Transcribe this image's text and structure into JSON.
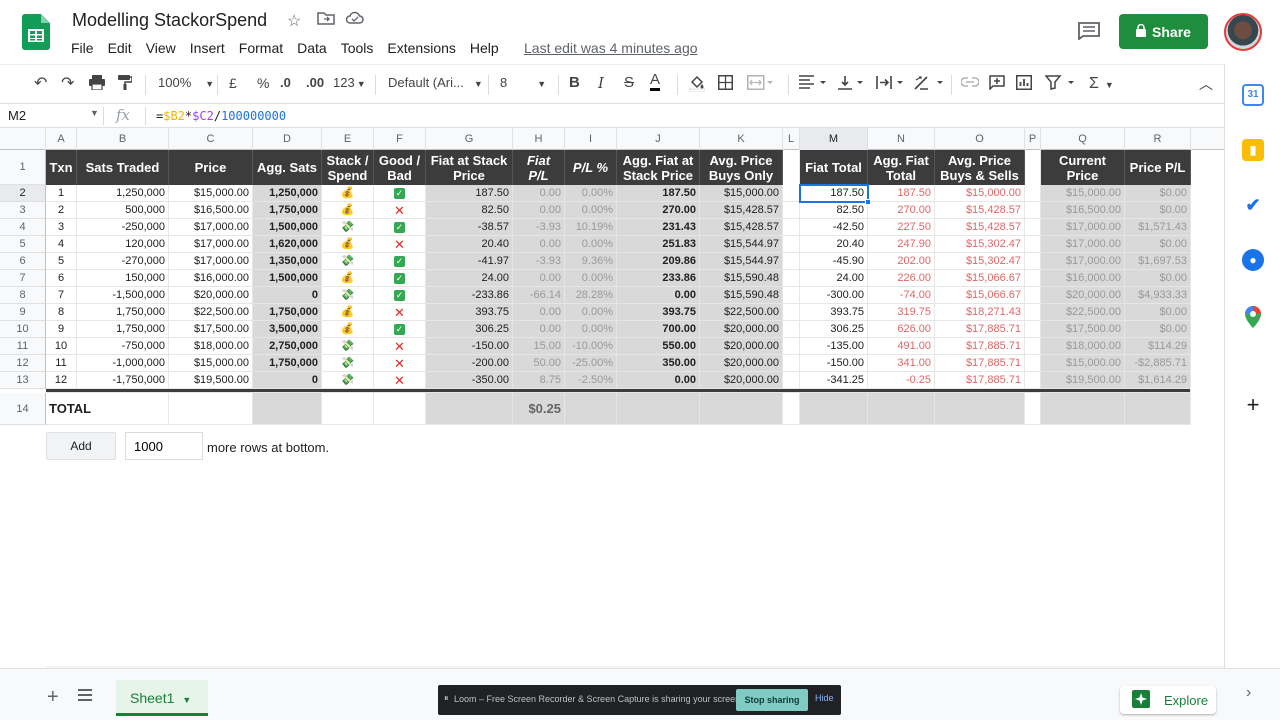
{
  "header": {
    "title": "Modelling StackorSpend",
    "menus": [
      "File",
      "Edit",
      "View",
      "Insert",
      "Format",
      "Data",
      "Tools",
      "Extensions",
      "Help"
    ],
    "last_edit": "Last edit was 4 minutes ago",
    "share_label": "Share"
  },
  "toolbar": {
    "zoom": "100%",
    "currency": "£",
    "percent": "%",
    "dec_decrease": ".0",
    "dec_increase": ".00",
    "more_formats": "123",
    "font": "Default (Ari...",
    "font_size": "8"
  },
  "formula_bar": {
    "name_box": "M2",
    "fx": "fx",
    "formula_prefix": "=",
    "formula_b": "$B2",
    "formula_op1": "*",
    "formula_c": "$C2",
    "formula_op2": "/",
    "formula_num": "100000000"
  },
  "columns": [
    "A",
    "B",
    "C",
    "D",
    "E",
    "F",
    "G",
    "H",
    "I",
    "J",
    "K",
    "L",
    "M",
    "N",
    "O",
    "P",
    "Q",
    "R"
  ],
  "selected_column": "M",
  "header_row": {
    "A": "Txn",
    "B": "Sats Traded",
    "C": "Price",
    "D": "Agg. Sats",
    "E": "Stack / Spend",
    "F": "Good / Bad",
    "G": "Fiat at Stack Price",
    "H": "Fiat P/L",
    "I": "P/L %",
    "J": "Agg. Fiat at Stack Price",
    "K": "Avg. Price Buys Only",
    "M": "Fiat Total",
    "N": "Agg. Fiat Total",
    "O": "Avg. Price Buys & Sells",
    "Q": "Current Price",
    "R": "Price P/L"
  },
  "rows": [
    {
      "A": "1",
      "B": "1,250,000",
      "C": "$15,000.00",
      "D": "1,250,000",
      "E": "stack",
      "F": "good",
      "G": "187.50",
      "H": "0.00",
      "I": "0.00%",
      "J": "187.50",
      "K": "$15,000.00",
      "M": "187.50",
      "N": "187.50",
      "O": "$15,000.00",
      "Q": "$15,000.00",
      "R": "$0.00"
    },
    {
      "A": "2",
      "B": "500,000",
      "C": "$16,500.00",
      "D": "1,750,000",
      "E": "stack",
      "F": "bad",
      "G": "82.50",
      "H": "0.00",
      "I": "0.00%",
      "J": "270.00",
      "K": "$15,428.57",
      "M": "82.50",
      "N": "270.00",
      "O": "$15,428.57",
      "Q": "$16,500.00",
      "R": "$0.00"
    },
    {
      "A": "3",
      "B": "-250,000",
      "C": "$17,000.00",
      "D": "1,500,000",
      "E": "spend",
      "F": "good",
      "G": "-38.57",
      "H": "-3.93",
      "I": "10.19%",
      "J": "231.43",
      "K": "$15,428.57",
      "M": "-42.50",
      "N": "227.50",
      "O": "$15,428.57",
      "Q": "$17,000.00",
      "R": "$1,571.43"
    },
    {
      "A": "4",
      "B": "120,000",
      "C": "$17,000.00",
      "D": "1,620,000",
      "E": "stack",
      "F": "bad",
      "G": "20.40",
      "H": "0.00",
      "I": "0.00%",
      "J": "251.83",
      "K": "$15,544.97",
      "M": "20.40",
      "N": "247.90",
      "O": "$15,302.47",
      "Q": "$17,000.00",
      "R": "$0.00"
    },
    {
      "A": "5",
      "B": "-270,000",
      "C": "$17,000.00",
      "D": "1,350,000",
      "E": "spend",
      "F": "good",
      "G": "-41.97",
      "H": "-3.93",
      "I": "9.36%",
      "J": "209.86",
      "K": "$15,544.97",
      "M": "-45.90",
      "N": "202.00",
      "O": "$15,302.47",
      "Q": "$17,000.00",
      "R": "$1,697.53"
    },
    {
      "A": "6",
      "B": "150,000",
      "C": "$16,000.00",
      "D": "1,500,000",
      "E": "stack",
      "F": "good",
      "G": "24.00",
      "H": "0.00",
      "I": "0.00%",
      "J": "233.86",
      "K": "$15,590.48",
      "M": "24.00",
      "N": "226.00",
      "O": "$15,066.67",
      "Q": "$16,000.00",
      "R": "$0.00"
    },
    {
      "A": "7",
      "B": "-1,500,000",
      "C": "$20,000.00",
      "D": "0",
      "E": "spend",
      "F": "good",
      "G": "-233.86",
      "H": "-66.14",
      "I": "28.28%",
      "J": "0.00",
      "K": "$15,590.48",
      "M": "-300.00",
      "N": "-74.00",
      "O": "$15,066.67",
      "Q": "$20,000.00",
      "R": "$4,933.33"
    },
    {
      "A": "8",
      "B": "1,750,000",
      "C": "$22,500.00",
      "D": "1,750,000",
      "E": "stack",
      "F": "bad",
      "G": "393.75",
      "H": "0.00",
      "I": "0.00%",
      "J": "393.75",
      "K": "$22,500.00",
      "M": "393.75",
      "N": "319.75",
      "O": "$18,271.43",
      "Q": "$22,500.00",
      "R": "$0.00"
    },
    {
      "A": "9",
      "B": "1,750,000",
      "C": "$17,500.00",
      "D": "3,500,000",
      "E": "stack",
      "F": "good",
      "G": "306.25",
      "H": "0.00",
      "I": "0.00%",
      "J": "700.00",
      "K": "$20,000.00",
      "M": "306.25",
      "N": "626.00",
      "O": "$17,885.71",
      "Q": "$17,500.00",
      "R": "$0.00"
    },
    {
      "A": "10",
      "B": "-750,000",
      "C": "$18,000.00",
      "D": "2,750,000",
      "E": "spend",
      "F": "bad",
      "G": "-150.00",
      "H": "15.00",
      "I": "-10.00%",
      "J": "550.00",
      "K": "$20,000.00",
      "M": "-135.00",
      "N": "491.00",
      "O": "$17,885.71",
      "Q": "$18,000.00",
      "R": "$114.29"
    },
    {
      "A": "11",
      "B": "-1,000,000",
      "C": "$15,000.00",
      "D": "1,750,000",
      "E": "spend",
      "F": "bad",
      "G": "-200.00",
      "H": "50.00",
      "I": "-25.00%",
      "J": "350.00",
      "K": "$20,000.00",
      "M": "-150.00",
      "N": "341.00",
      "O": "$17,885.71",
      "Q": "$15,000.00",
      "R": "-$2,885.71"
    },
    {
      "A": "12",
      "B": "-1,750,000",
      "C": "$19,500.00",
      "D": "0",
      "E": "spend",
      "F": "bad",
      "G": "-350.00",
      "H": "8.75",
      "I": "-2.50%",
      "J": "0.00",
      "K": "$20,000.00",
      "M": "-341.25",
      "N": "-0.25",
      "O": "$17,885.71",
      "Q": "$19,500.00",
      "R": "$1,614.29"
    }
  ],
  "row_numbers": [
    "1",
    "2",
    "3",
    "4",
    "5",
    "6",
    "7",
    "8",
    "9",
    "10",
    "11",
    "12",
    "13",
    "14"
  ],
  "total_row": {
    "label": "TOTAL",
    "H": "$0.25"
  },
  "icons": {
    "stack": "money-bag",
    "spend": "money-wings",
    "good": "check-box",
    "bad": "red-x"
  },
  "add_rows": {
    "button": "Add",
    "value": "1000",
    "label": "more rows at bottom."
  },
  "sheet": {
    "tab": "Sheet1"
  },
  "loom": {
    "text": "Loom – Free Screen Recorder & Screen Capture is sharing your screen.",
    "stop": "Stop sharing",
    "hide": "Hide"
  },
  "explore": {
    "label": "Explore"
  },
  "colors": {
    "share": "#1e8e3e",
    "header_bg": "#3c3c3c",
    "gray_col": "#d9d9d9",
    "red_text": "#e06666",
    "selection": "#1a73e8"
  }
}
